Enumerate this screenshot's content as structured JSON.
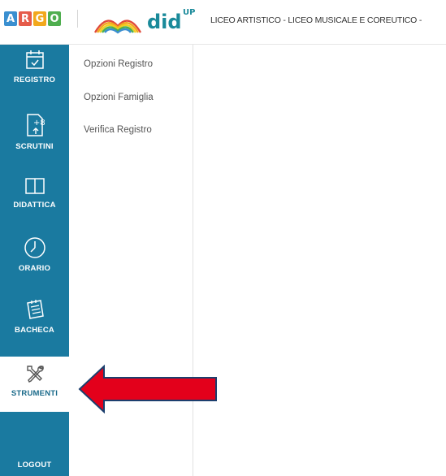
{
  "header": {
    "argo_letters": [
      "A",
      "R",
      "G",
      "O"
    ],
    "argo_colors": [
      "#3a8fd0",
      "#e55b4a",
      "#f2a81d",
      "#4fae4f"
    ],
    "app_name": "did",
    "app_sup": "UP",
    "school_name": "LICEO ARTISTICO - LICEO MUSICALE E COREUTICO -"
  },
  "sidebar": {
    "items": [
      {
        "label": "REGISTRO",
        "icon": "calendar-check-icon"
      },
      {
        "label": "SCRUTINI",
        "icon": "document-plus-icon"
      },
      {
        "label": "DIDATTICA",
        "icon": "book-icon"
      },
      {
        "label": "ORARIO",
        "icon": "clock-icon"
      },
      {
        "label": "BACHECA",
        "icon": "notepad-icon"
      },
      {
        "label": "STRUMENTI",
        "icon": "tools-icon",
        "active": true
      },
      {
        "label": "LOGOUT",
        "icon": "logout-icon"
      }
    ]
  },
  "submenu": {
    "items": [
      {
        "label": "Opzioni Registro"
      },
      {
        "label": "Opzioni Famiglia"
      },
      {
        "label": "Verifica Registro"
      }
    ]
  },
  "colors": {
    "sidebar_bg": "#1a7aa0",
    "brand_teal": "#1a8a9a",
    "arrow_red": "#e3001b",
    "arrow_border": "#1c3f6e"
  }
}
